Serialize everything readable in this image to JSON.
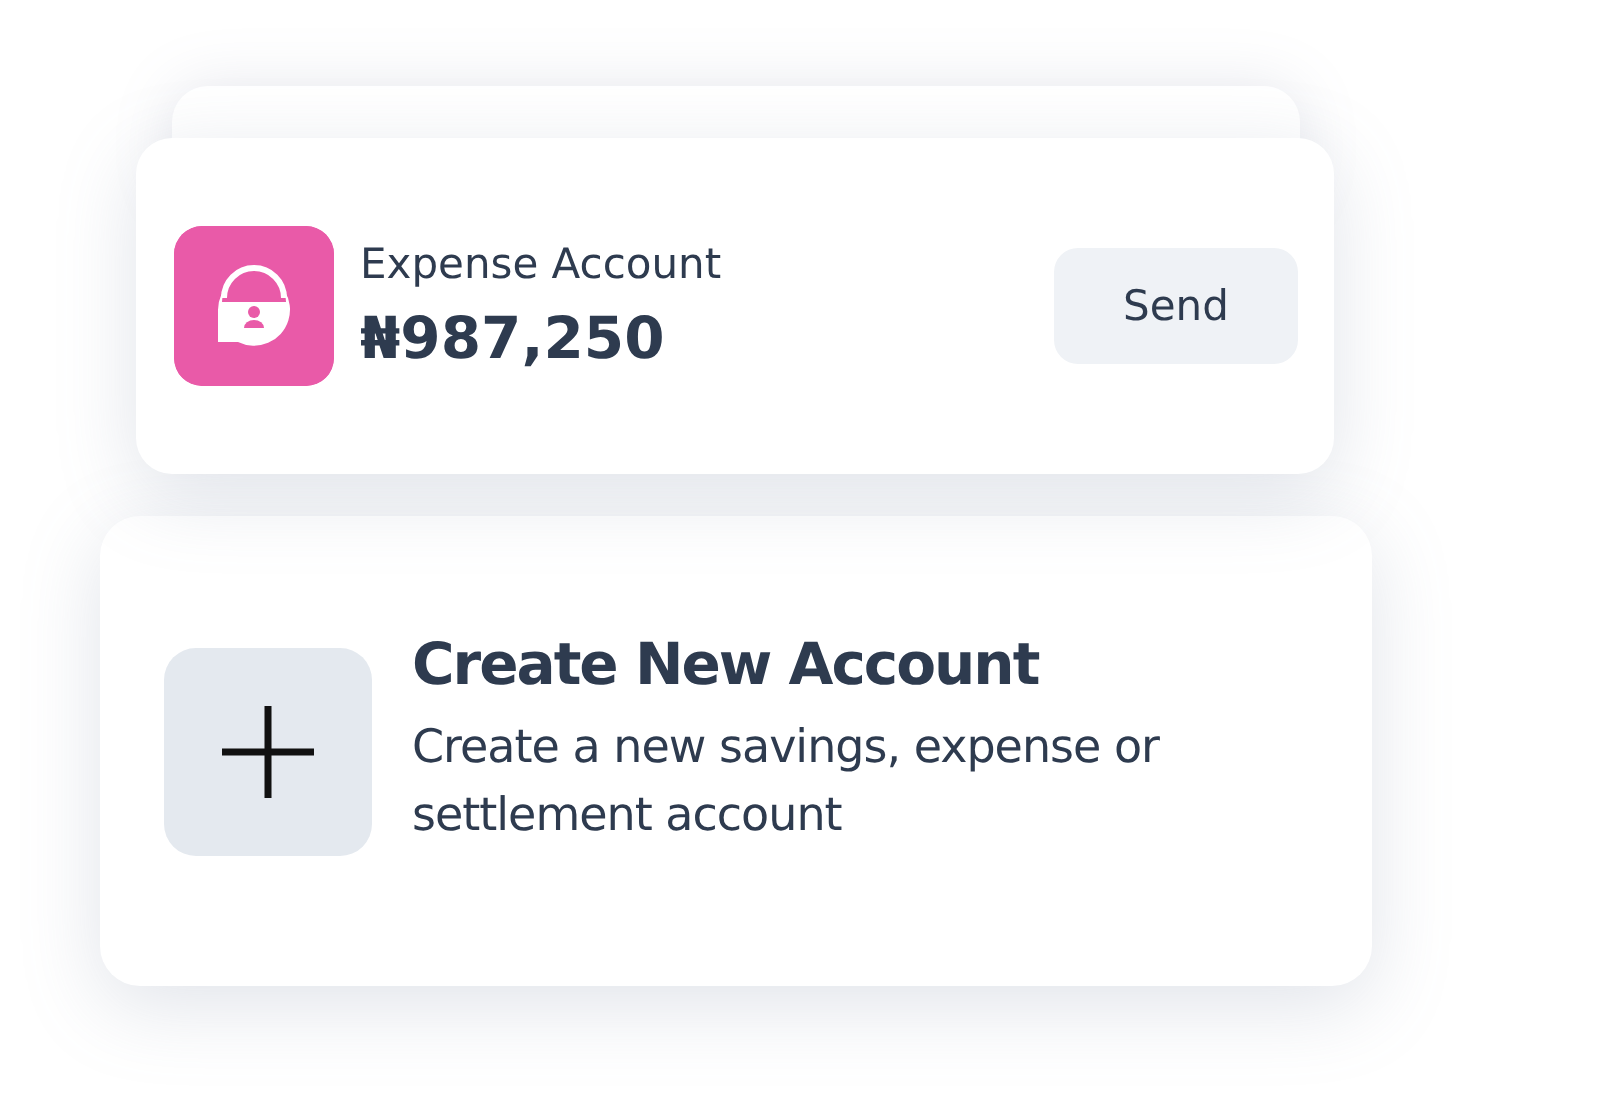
{
  "account": {
    "name": "Expense Account",
    "balance": "₦987,250",
    "action": "Send"
  },
  "create": {
    "title": "Create New Account",
    "description": "Create a new savings, expense or settlement account"
  }
}
